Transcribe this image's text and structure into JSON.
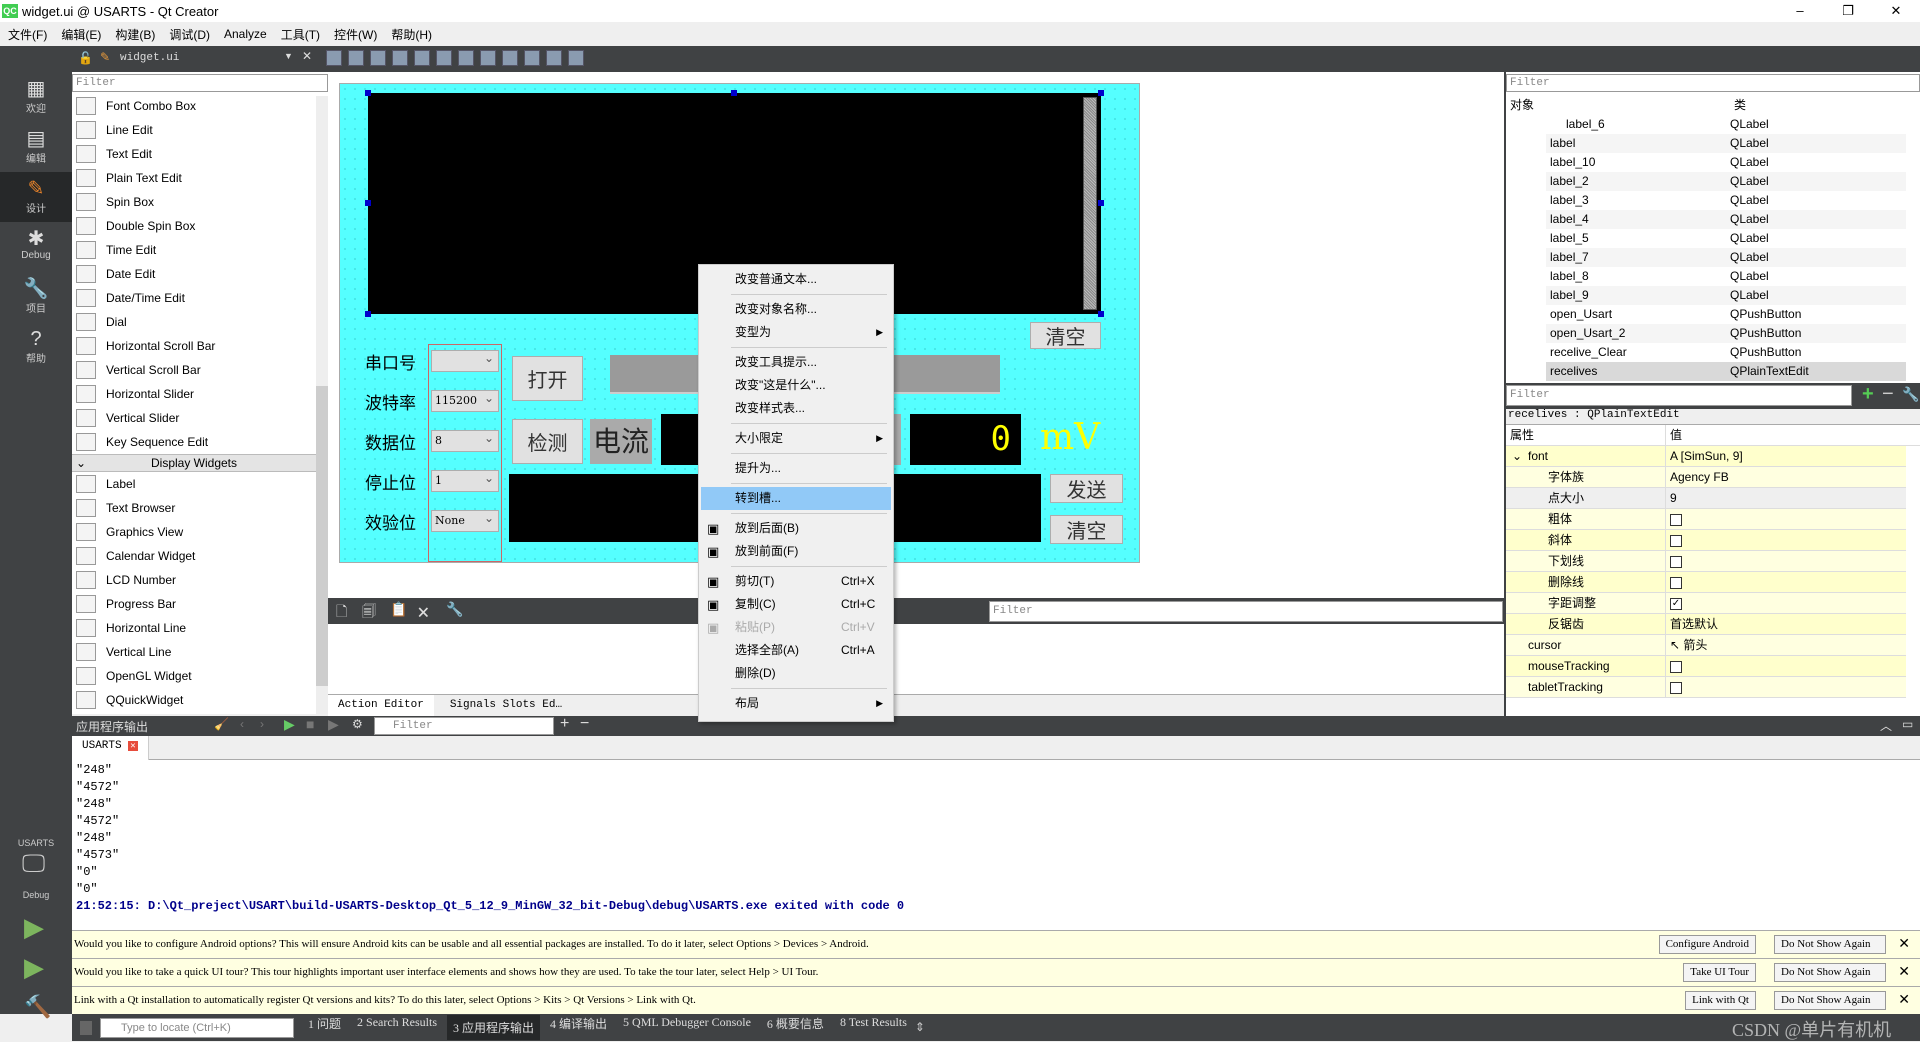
{
  "title": "widget.ui @ USARTS - Qt Creator",
  "app_logo": "QC",
  "menus": [
    "文件(F)",
    "编辑(E)",
    "构建(B)",
    "调试(D)",
    "Analyze",
    "工具(T)",
    "控件(W)",
    "帮助(H)"
  ],
  "toolbar": {
    "file": "widget.ui"
  },
  "modes": [
    {
      "label": "欢迎",
      "icon": "grid-icon",
      "g": "▦"
    },
    {
      "label": "编辑",
      "icon": "document-icon",
      "g": "▤"
    },
    {
      "label": "设计",
      "icon": "pencil-icon",
      "g": "✎"
    },
    {
      "label": "Debug",
      "icon": "bug-icon",
      "g": "✱"
    },
    {
      "label": "项目",
      "icon": "wrench-icon",
      "g": "🔧"
    },
    {
      "label": "帮助",
      "icon": "help-icon",
      "g": "?"
    }
  ],
  "kit": {
    "project": "USARTS",
    "mode": "Debug"
  },
  "widget_box": {
    "filter_placeholder": "Filter",
    "items_a": [
      "Font Combo Box",
      "Line Edit",
      "Text Edit",
      "Plain Text Edit",
      "Spin Box",
      "Double Spin Box",
      "Time Edit",
      "Date Edit",
      "Date/Time Edit",
      "Dial",
      "Horizontal Scroll Bar",
      "Vertical Scroll Bar",
      "Horizontal Slider",
      "Vertical Slider",
      "Key Sequence Edit"
    ],
    "category": "Display Widgets",
    "items_b": [
      "Label",
      "Text Browser",
      "Graphics View",
      "Calendar Widget",
      "LCD Number",
      "Progress Bar",
      "Horizontal Line",
      "Vertical Line",
      "OpenGL Widget",
      "QQuickWidget"
    ]
  },
  "form": {
    "labels": [
      "串口号",
      "波特率",
      "数据位",
      "停止位",
      "效验位"
    ],
    "combos": [
      "",
      "115200",
      "8",
      "1",
      "None"
    ],
    "open": "打开",
    "detect": "检测",
    "current": "电流",
    "lcd": "0",
    "unit": "mV",
    "send": "发送",
    "clear": "清空",
    "clear2": "清空"
  },
  "context_menu": [
    {
      "t": "改变普通文本..."
    },
    {
      "sep": true
    },
    {
      "t": "改变对象名称..."
    },
    {
      "t": "变型为",
      "sub": true
    },
    {
      "sep": true
    },
    {
      "t": "改变工具提示..."
    },
    {
      "t": "改变\"这是什么\"..."
    },
    {
      "t": "改变样式表..."
    },
    {
      "sep": true
    },
    {
      "t": "大小限定",
      "sub": true
    },
    {
      "sep": true
    },
    {
      "t": "提升为..."
    },
    {
      "sep": true
    },
    {
      "t": "转到槽...",
      "hl": true
    },
    {
      "sep": true
    },
    {
      "t": "放到后面(B)",
      "icon": "send-back-icon"
    },
    {
      "t": "放到前面(F)",
      "icon": "bring-front-icon"
    },
    {
      "sep": true
    },
    {
      "t": "剪切(T)",
      "sc": "Ctrl+X",
      "icon": "scissors-icon"
    },
    {
      "t": "复制(C)",
      "sc": "Ctrl+C",
      "icon": "copy-icon"
    },
    {
      "t": "粘贴(P)",
      "sc": "Ctrl+V",
      "dis": true,
      "icon": "paste-icon"
    },
    {
      "t": "选择全部(A)",
      "sc": "Ctrl+A"
    },
    {
      "t": "删除(D)"
    },
    {
      "sep": true
    },
    {
      "t": "布局",
      "sub": true
    }
  ],
  "action_editor": {
    "filter_placeholder": "Filter",
    "tabs": [
      "Action Editor",
      "Signals  Slots Ed…"
    ]
  },
  "object_inspector": {
    "filter_placeholder": "Filter",
    "headers": [
      "对象",
      "类"
    ],
    "rows": [
      [
        "label_6",
        "QLabel"
      ],
      [
        "label",
        "QLabel"
      ],
      [
        "label_10",
        "QLabel"
      ],
      [
        "label_2",
        "QLabel"
      ],
      [
        "label_3",
        "QLabel"
      ],
      [
        "label_4",
        "QLabel"
      ],
      [
        "label_5",
        "QLabel"
      ],
      [
        "label_7",
        "QLabel"
      ],
      [
        "label_8",
        "QLabel"
      ],
      [
        "label_9",
        "QLabel"
      ],
      [
        "open_Usart",
        "QPushButton"
      ],
      [
        "open_Usart_2",
        "QPushButton"
      ],
      [
        "recelive_Clear",
        "QPushButton"
      ],
      [
        "recelives",
        "QPlainTextEdit"
      ]
    ],
    "selected": "recelives"
  },
  "property_editor": {
    "filter_placeholder": "Filter",
    "object": "recelives : QPlainTextEdit",
    "headers": [
      "属性",
      "值"
    ],
    "rows": [
      {
        "n": "font",
        "v": "A  [SimSun, 9]",
        "lvl": 0,
        "exp": true
      },
      {
        "n": "字体族",
        "v": "Agency FB",
        "lvl": 1
      },
      {
        "n": "点大小",
        "v": "9",
        "lvl": 1
      },
      {
        "n": "粗体",
        "cb": false,
        "lvl": 1
      },
      {
        "n": "斜体",
        "cb": false,
        "lvl": 1
      },
      {
        "n": "下划线",
        "cb": false,
        "lvl": 1
      },
      {
        "n": "删除线",
        "cb": false,
        "lvl": 1
      },
      {
        "n": "字距调整",
        "cb": true,
        "lvl": 1
      },
      {
        "n": "反锯齿",
        "v": "首选默认",
        "lvl": 1
      },
      {
        "n": "cursor",
        "v": "↖  箭头",
        "lvl": 0
      },
      {
        "n": "mouseTracking",
        "cb": false,
        "lvl": 0
      },
      {
        "n": "tabletTracking",
        "cb": false,
        "lvl": 0
      }
    ]
  },
  "output": {
    "title": "应用程序输出",
    "filter_placeholder": "Filter",
    "tab": "USARTS",
    "lines": [
      "\"248\"",
      "\"4572\"",
      "\"248\"",
      "\"4572\"",
      "\"248\"",
      "\"4573\"",
      "\"0\"",
      "\"0\""
    ],
    "exit_line": "21:52:15: D:\\Qt_preject\\USART\\build-USARTS-Desktop_Qt_5_12_9_MinGW_32_bit-Debug\\debug\\USARTS.exe exited with code 0"
  },
  "info_bars": [
    {
      "text": "Would you like to configure Android options? This will ensure Android kits can be usable and all essential packages are installed. To do it later, select Options > Devices > Android.",
      "button": "Configure Android",
      "dismiss": "Do Not Show Again"
    },
    {
      "text": "Would you like to take a quick UI tour? This tour highlights important user interface elements and shows how they are used. To take the tour later, select Help > UI Tour.",
      "button": "Take UI Tour",
      "dismiss": "Do Not Show Again"
    },
    {
      "text": "Link with a Qt installation to automatically register Qt versions and kits? To do this later, select Options > Kits > Qt Versions > Link with Qt.",
      "button": "Link with Qt",
      "dismiss": "Do Not Show Again"
    }
  ],
  "statusbar": {
    "locate_placeholder": "Type to locate (Ctrl+K)",
    "tabs": [
      "1 问题",
      "2 Search Results",
      "3 应用程序输出",
      "4 编译输出",
      "5 QML Debugger Console",
      "6 概要信息",
      "8 Test Results"
    ],
    "active": 2
  },
  "watermark": "CSDN @单片有机机",
  "colors": {
    "form_bg": "#55ffff",
    "dark": "#404244",
    "highlight": "#91c9f7",
    "lcd": "#ffff00",
    "prop_bg": "#ffffcc"
  }
}
